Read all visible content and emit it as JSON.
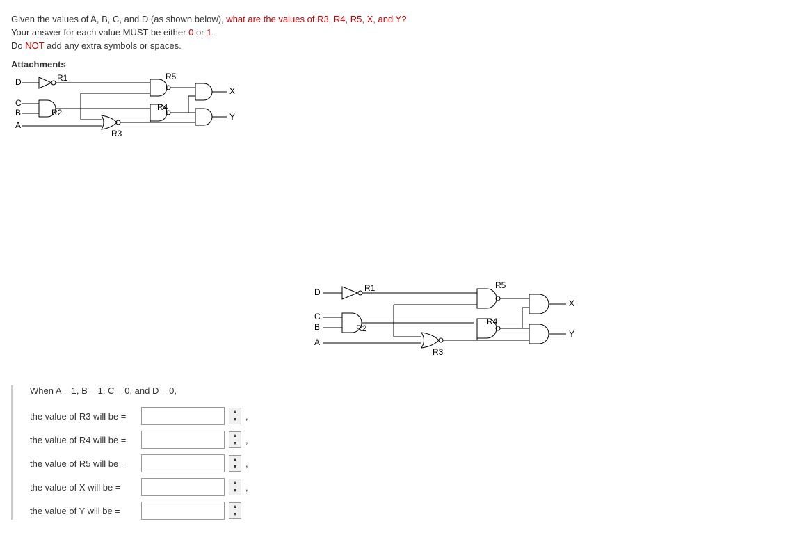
{
  "question": {
    "line1_pre": "Given the values of A, B, C, and D (as shown below), ",
    "line1_red": "what are the values of R3, R4, R5, X, and Y?",
    "line2_pre": "Your answer for each value MUST be either ",
    "line2_red0": "0",
    "line2_mid": " or ",
    "line2_red1": "1",
    "line2_post": ".",
    "line3_pre": "Do ",
    "line3_red": "NOT",
    "line3_post": " add any extra symbols or spaces."
  },
  "attachments_label": "Attachments",
  "circuit": {
    "inputs": [
      "D",
      "C",
      "B",
      "A"
    ],
    "gates": {
      "R1": "NOT",
      "R2": "AND",
      "R3": "NOR",
      "R4": "NAND",
      "R5": "NAND",
      "X": "AND",
      "Y": "AND"
    }
  },
  "given": "When A = 1, B = 1, C = 0, and D = 0,",
  "rows": [
    {
      "label": "the value of R3 will be =",
      "comma": ","
    },
    {
      "label": "the value of R4 will be =",
      "comma": ","
    },
    {
      "label": "the value of R5 will be =",
      "comma": ","
    },
    {
      "label": "the value of X will be =",
      "comma": ","
    },
    {
      "label": "the value of Y will be =",
      "comma": ""
    }
  ]
}
